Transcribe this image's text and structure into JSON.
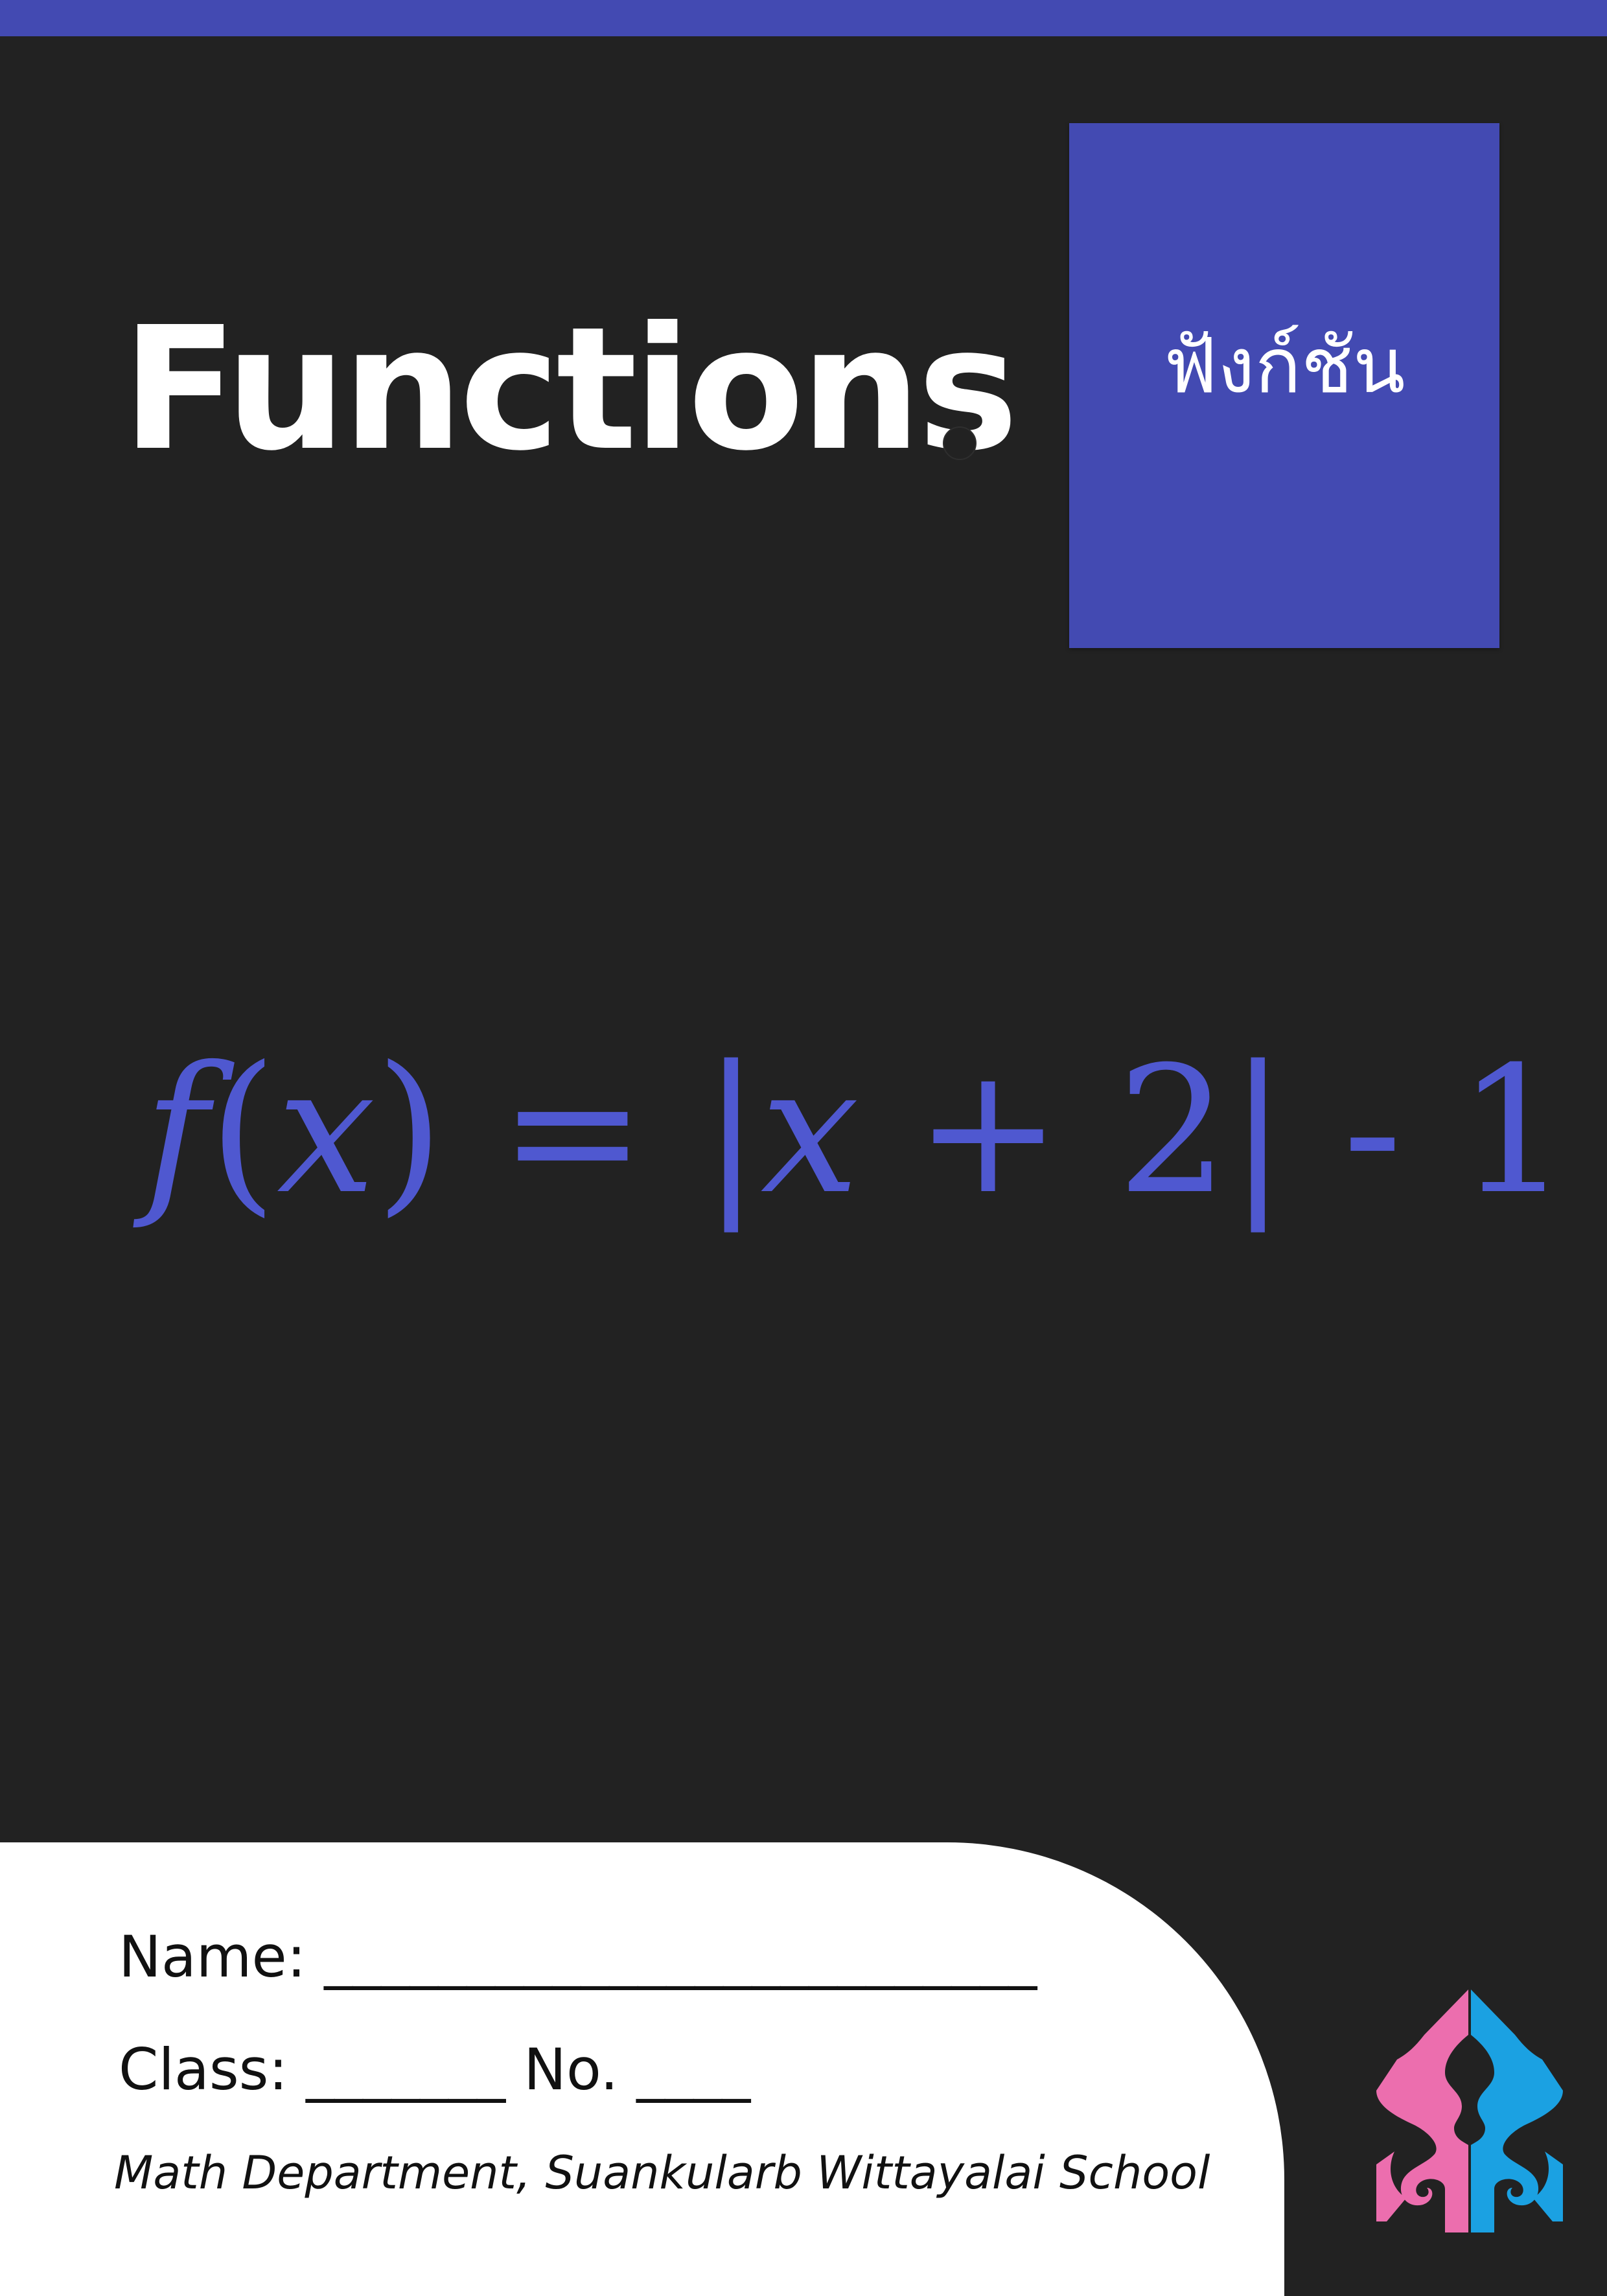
{
  "cover": {
    "title": "Functions",
    "thai_title": "ฟังก์ชัน",
    "formula": {
      "f": "f",
      "lparen": "(",
      "x1": "x",
      "rparen": ")",
      "equals": " = |",
      "x2": "x",
      "rest": " + 2| - 1"
    }
  },
  "form": {
    "name_label": "Name:",
    "name_blank": "_________________________",
    "class_label": "Class:",
    "class_blank": "_______",
    "no_label": "No.",
    "no_blank": "____",
    "department": "Math Department, Suankularb Wittayalai School"
  },
  "colors": {
    "accent": "#434AB2",
    "formula": "#4F58D0",
    "background": "#222222",
    "logo_pink": "#EC6EAE",
    "logo_blue": "#1BA1E2"
  },
  "logo": {
    "name": "school-emblem"
  }
}
